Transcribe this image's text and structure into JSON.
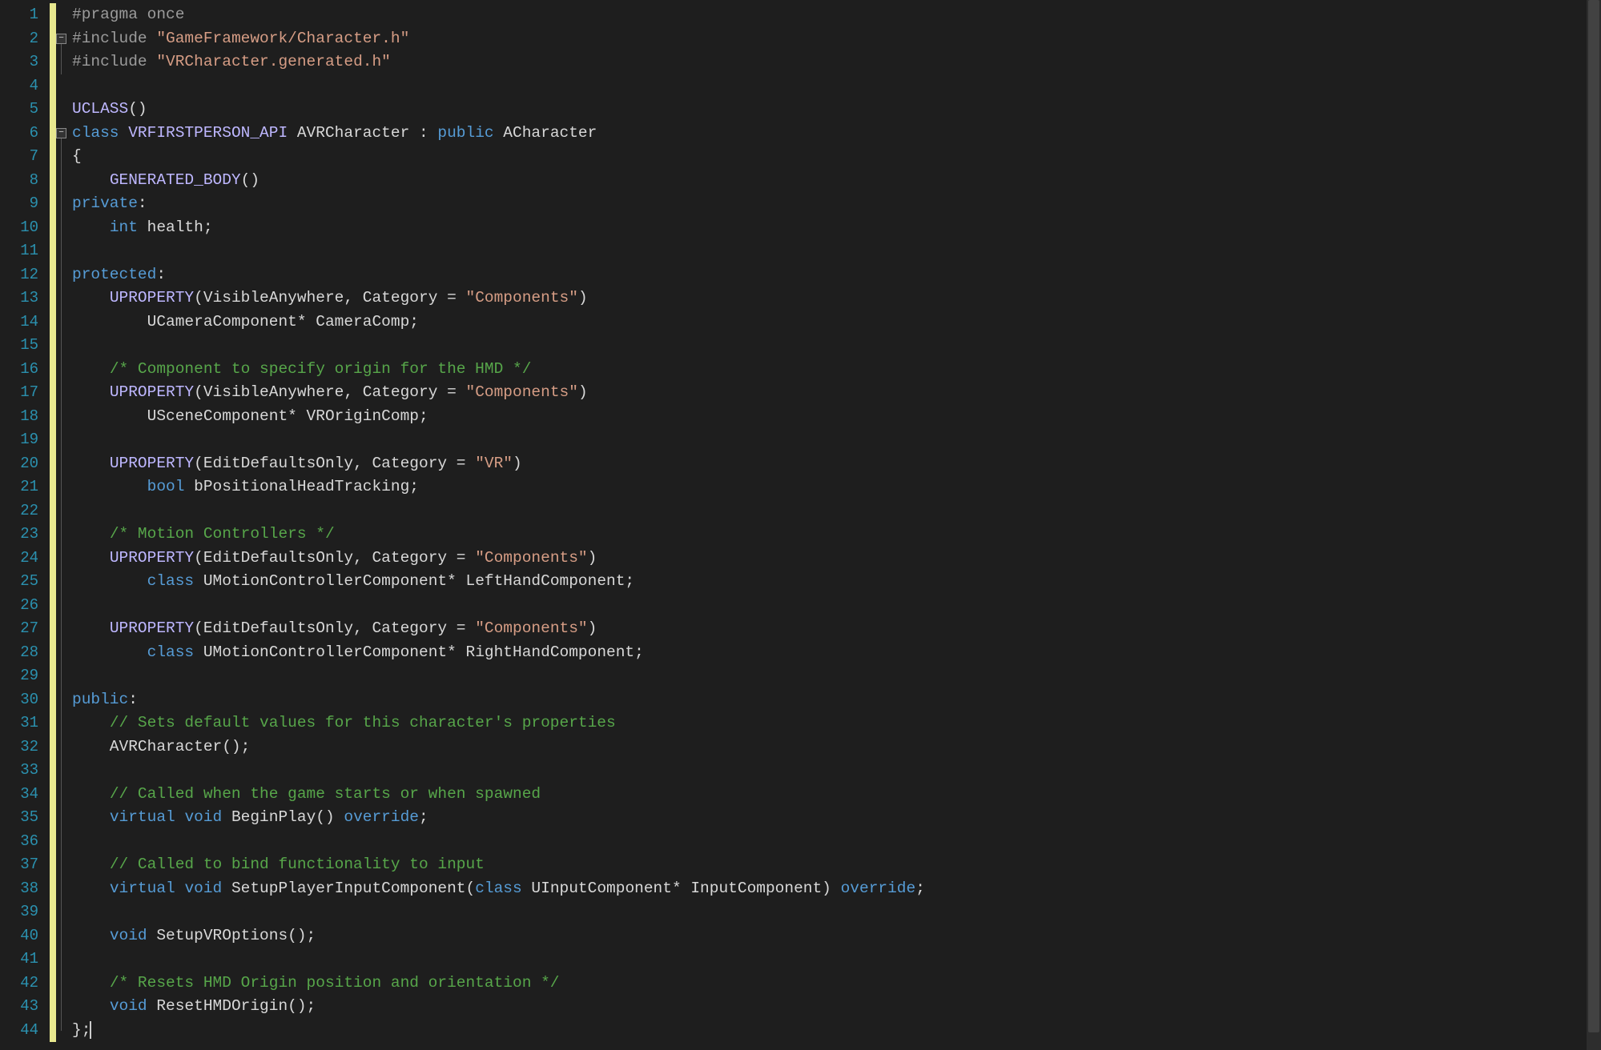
{
  "colors": {
    "background": "#1e1e1e",
    "line_number": "#2b91af",
    "modified_bar": "#e8e88f",
    "keyword": "#569cd6",
    "preprocessor": "#9b9b9b",
    "string": "#d69d85",
    "comment": "#57a64a",
    "macro": "#beb7ff",
    "default": "#d8d8d8"
  },
  "line_numbers": [
    "1",
    "2",
    "3",
    "4",
    "5",
    "6",
    "7",
    "8",
    "9",
    "10",
    "11",
    "12",
    "13",
    "14",
    "15",
    "16",
    "17",
    "18",
    "19",
    "20",
    "21",
    "22",
    "23",
    "24",
    "25",
    "26",
    "27",
    "28",
    "29",
    "30",
    "31",
    "32",
    "33",
    "34",
    "35",
    "36",
    "37",
    "38",
    "39",
    "40",
    "41",
    "42",
    "43",
    "44"
  ],
  "fold_boxes": {
    "line2": "-",
    "line3": "|",
    "line6": "-"
  },
  "code_lines": [
    {
      "n": 1,
      "seg": [
        {
          "t": "#pragma",
          "c": "pp"
        },
        {
          "t": " ",
          "c": ""
        },
        {
          "t": "once",
          "c": "pp"
        }
      ]
    },
    {
      "n": 2,
      "seg": [
        {
          "t": "#include",
          "c": "pp"
        },
        {
          "t": " ",
          "c": ""
        },
        {
          "t": "\"GameFramework/Character.h\"",
          "c": "str"
        }
      ]
    },
    {
      "n": 3,
      "seg": [
        {
          "t": "#include",
          "c": "pp"
        },
        {
          "t": " ",
          "c": ""
        },
        {
          "t": "\"VRCharacter.generated.h\"",
          "c": "str"
        }
      ]
    },
    {
      "n": 4,
      "seg": []
    },
    {
      "n": 5,
      "seg": [
        {
          "t": "UCLASS",
          "c": "mac"
        },
        {
          "t": "()",
          "c": ""
        }
      ]
    },
    {
      "n": 6,
      "seg": [
        {
          "t": "class",
          "c": "kw"
        },
        {
          "t": " ",
          "c": ""
        },
        {
          "t": "VRFIRSTPERSON_API",
          "c": "mac"
        },
        {
          "t": " AVRCharacter : ",
          "c": ""
        },
        {
          "t": "public",
          "c": "kw"
        },
        {
          "t": " ACharacter",
          "c": ""
        }
      ]
    },
    {
      "n": 7,
      "seg": [
        {
          "t": "{",
          "c": ""
        }
      ]
    },
    {
      "n": 8,
      "seg": [
        {
          "t": "    ",
          "c": ""
        },
        {
          "t": "GENERATED_BODY",
          "c": "mac"
        },
        {
          "t": "()",
          "c": ""
        }
      ]
    },
    {
      "n": 9,
      "seg": [
        {
          "t": "private",
          "c": "kw"
        },
        {
          "t": ":",
          "c": ""
        }
      ]
    },
    {
      "n": 10,
      "seg": [
        {
          "t": "    ",
          "c": ""
        },
        {
          "t": "int",
          "c": "kw"
        },
        {
          "t": " health;",
          "c": ""
        }
      ]
    },
    {
      "n": 11,
      "seg": []
    },
    {
      "n": 12,
      "seg": [
        {
          "t": "protected",
          "c": "kw"
        },
        {
          "t": ":",
          "c": ""
        }
      ]
    },
    {
      "n": 13,
      "seg": [
        {
          "t": "    ",
          "c": ""
        },
        {
          "t": "UPROPERTY",
          "c": "mac"
        },
        {
          "t": "(VisibleAnywhere, Category = ",
          "c": ""
        },
        {
          "t": "\"Components\"",
          "c": "str"
        },
        {
          "t": ")",
          "c": ""
        }
      ]
    },
    {
      "n": 14,
      "seg": [
        {
          "t": "        UCameraComponent* CameraComp;",
          "c": ""
        }
      ]
    },
    {
      "n": 15,
      "seg": []
    },
    {
      "n": 16,
      "seg": [
        {
          "t": "    ",
          "c": ""
        },
        {
          "t": "/* Component to specify origin for the HMD */",
          "c": "cm"
        }
      ]
    },
    {
      "n": 17,
      "seg": [
        {
          "t": "    ",
          "c": ""
        },
        {
          "t": "UPROPERTY",
          "c": "mac"
        },
        {
          "t": "(VisibleAnywhere, Category = ",
          "c": ""
        },
        {
          "t": "\"Components\"",
          "c": "str"
        },
        {
          "t": ")",
          "c": ""
        }
      ]
    },
    {
      "n": 18,
      "seg": [
        {
          "t": "        USceneComponent* VROriginComp;",
          "c": ""
        }
      ]
    },
    {
      "n": 19,
      "seg": []
    },
    {
      "n": 20,
      "seg": [
        {
          "t": "    ",
          "c": ""
        },
        {
          "t": "UPROPERTY",
          "c": "mac"
        },
        {
          "t": "(EditDefaultsOnly, Category = ",
          "c": ""
        },
        {
          "t": "\"VR\"",
          "c": "str"
        },
        {
          "t": ")",
          "c": ""
        }
      ]
    },
    {
      "n": 21,
      "seg": [
        {
          "t": "        ",
          "c": ""
        },
        {
          "t": "bool",
          "c": "kw"
        },
        {
          "t": " bPositionalHeadTracking;",
          "c": ""
        }
      ]
    },
    {
      "n": 22,
      "seg": []
    },
    {
      "n": 23,
      "seg": [
        {
          "t": "    ",
          "c": ""
        },
        {
          "t": "/* Motion Controllers */",
          "c": "cm"
        }
      ]
    },
    {
      "n": 24,
      "seg": [
        {
          "t": "    ",
          "c": ""
        },
        {
          "t": "UPROPERTY",
          "c": "mac"
        },
        {
          "t": "(EditDefaultsOnly, Category = ",
          "c": ""
        },
        {
          "t": "\"Components\"",
          "c": "str"
        },
        {
          "t": ")",
          "c": ""
        }
      ]
    },
    {
      "n": 25,
      "seg": [
        {
          "t": "        ",
          "c": ""
        },
        {
          "t": "class",
          "c": "kw"
        },
        {
          "t": " UMotionControllerComponent* LeftHandComponent;",
          "c": ""
        }
      ]
    },
    {
      "n": 26,
      "seg": []
    },
    {
      "n": 27,
      "seg": [
        {
          "t": "    ",
          "c": ""
        },
        {
          "t": "UPROPERTY",
          "c": "mac"
        },
        {
          "t": "(EditDefaultsOnly, Category = ",
          "c": ""
        },
        {
          "t": "\"Components\"",
          "c": "str"
        },
        {
          "t": ")",
          "c": ""
        }
      ]
    },
    {
      "n": 28,
      "seg": [
        {
          "t": "        ",
          "c": ""
        },
        {
          "t": "class",
          "c": "kw"
        },
        {
          "t": " UMotionControllerComponent* RightHandComponent;",
          "c": ""
        }
      ]
    },
    {
      "n": 29,
      "seg": []
    },
    {
      "n": 30,
      "seg": [
        {
          "t": "public",
          "c": "kw"
        },
        {
          "t": ":",
          "c": ""
        }
      ]
    },
    {
      "n": 31,
      "seg": [
        {
          "t": "    ",
          "c": ""
        },
        {
          "t": "// Sets default values for this character's properties",
          "c": "cm"
        }
      ]
    },
    {
      "n": 32,
      "seg": [
        {
          "t": "    AVRCharacter();",
          "c": ""
        }
      ]
    },
    {
      "n": 33,
      "seg": []
    },
    {
      "n": 34,
      "seg": [
        {
          "t": "    ",
          "c": ""
        },
        {
          "t": "// Called when the game starts or when spawned",
          "c": "cm"
        }
      ]
    },
    {
      "n": 35,
      "seg": [
        {
          "t": "    ",
          "c": ""
        },
        {
          "t": "virtual",
          "c": "kw"
        },
        {
          "t": " ",
          "c": ""
        },
        {
          "t": "void",
          "c": "kw"
        },
        {
          "t": " BeginPlay() ",
          "c": ""
        },
        {
          "t": "override",
          "c": "kw"
        },
        {
          "t": ";",
          "c": ""
        }
      ]
    },
    {
      "n": 36,
      "seg": []
    },
    {
      "n": 37,
      "seg": [
        {
          "t": "    ",
          "c": ""
        },
        {
          "t": "// Called to bind functionality to input",
          "c": "cm"
        }
      ]
    },
    {
      "n": 38,
      "seg": [
        {
          "t": "    ",
          "c": ""
        },
        {
          "t": "virtual",
          "c": "kw"
        },
        {
          "t": " ",
          "c": ""
        },
        {
          "t": "void",
          "c": "kw"
        },
        {
          "t": " SetupPlayerInputComponent(",
          "c": ""
        },
        {
          "t": "class",
          "c": "kw"
        },
        {
          "t": " UInputComponent* InputComponent) ",
          "c": ""
        },
        {
          "t": "override",
          "c": "kw"
        },
        {
          "t": ";",
          "c": ""
        }
      ]
    },
    {
      "n": 39,
      "seg": []
    },
    {
      "n": 40,
      "seg": [
        {
          "t": "    ",
          "c": ""
        },
        {
          "t": "void",
          "c": "kw"
        },
        {
          "t": " SetupVROptions();",
          "c": ""
        }
      ]
    },
    {
      "n": 41,
      "seg": []
    },
    {
      "n": 42,
      "seg": [
        {
          "t": "    ",
          "c": ""
        },
        {
          "t": "/* Resets HMD Origin position and orientation */",
          "c": "cm"
        }
      ]
    },
    {
      "n": 43,
      "seg": [
        {
          "t": "    ",
          "c": ""
        },
        {
          "t": "void",
          "c": "kw"
        },
        {
          "t": " ResetHMDOrigin();",
          "c": ""
        }
      ]
    },
    {
      "n": 44,
      "seg": [
        {
          "t": "};",
          "c": ""
        }
      ],
      "caret": true
    }
  ]
}
